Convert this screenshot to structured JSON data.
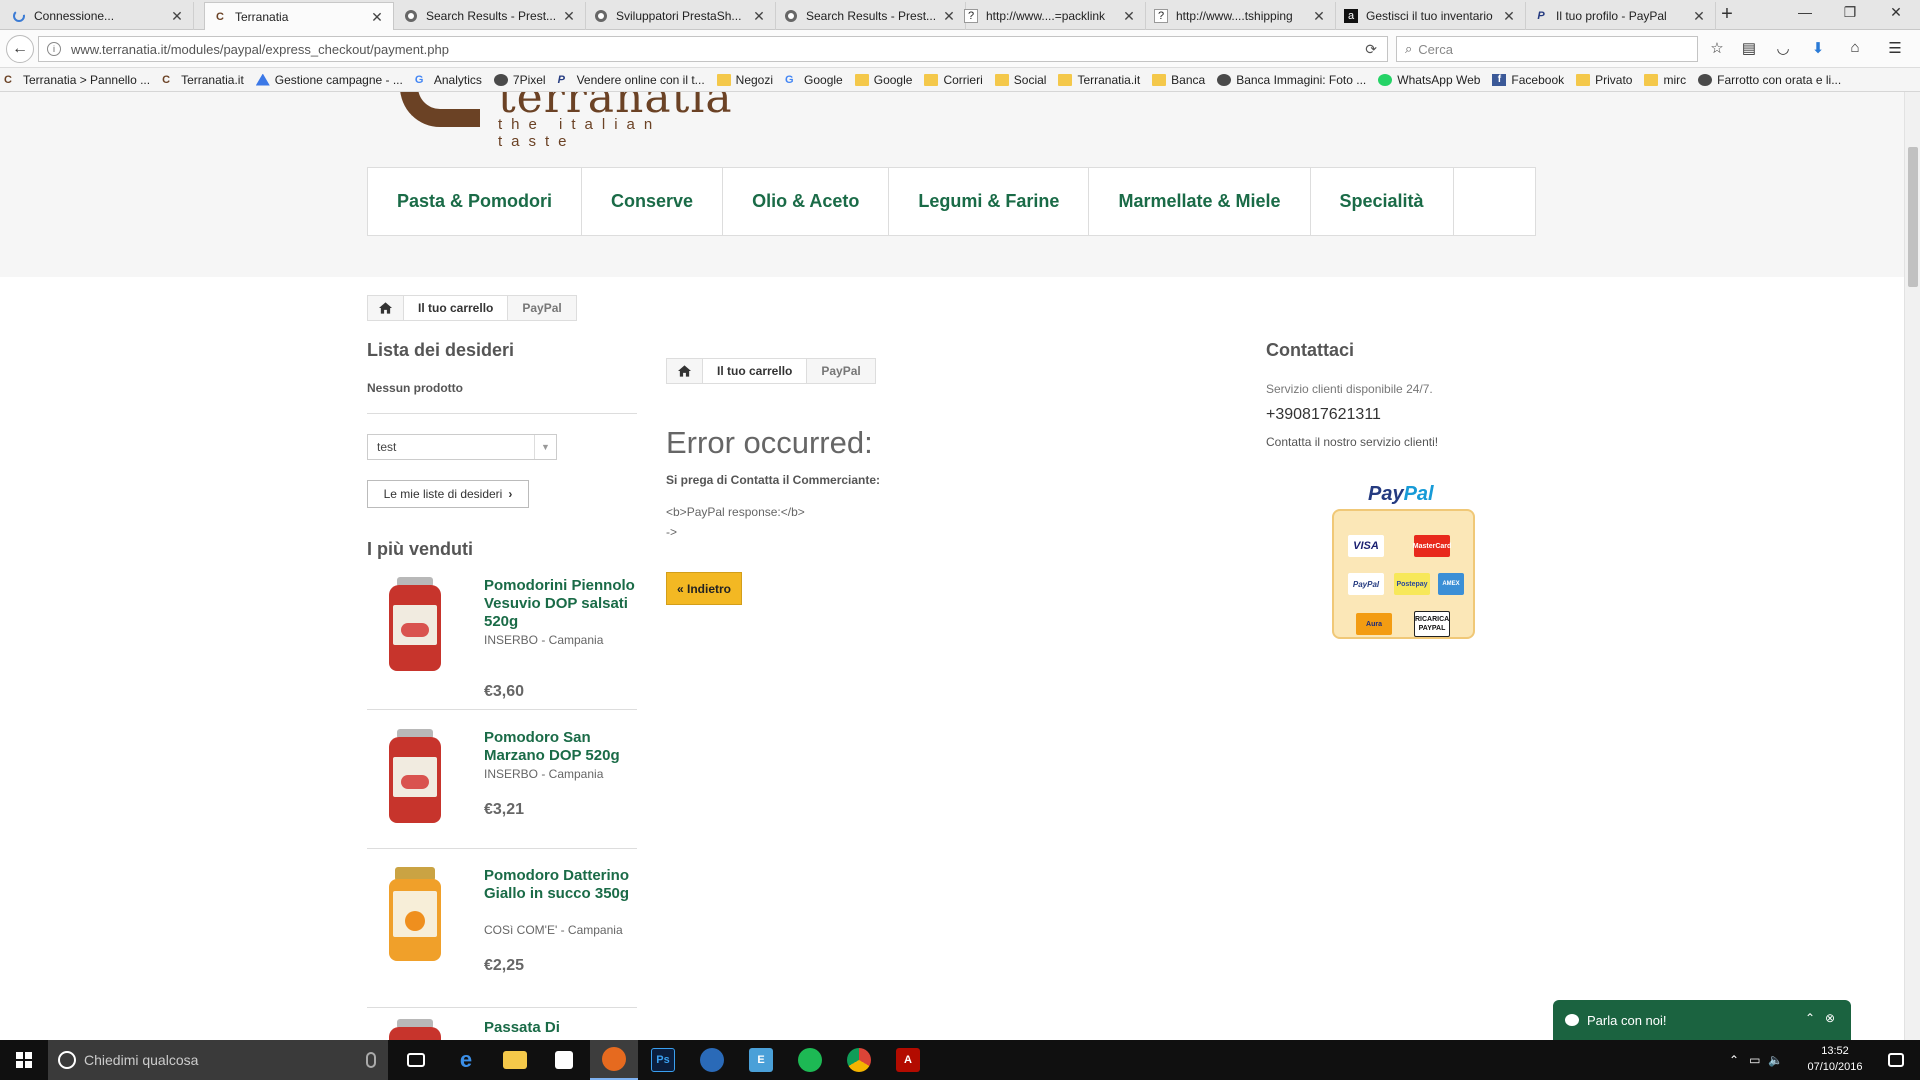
{
  "browser": {
    "tabs": [
      {
        "label": "Connessione...",
        "icon": "loading-icon"
      },
      {
        "label": "Terranatia",
        "icon": "terranatia-favicon",
        "active": true
      },
      {
        "label": "Search Results - Prest...",
        "icon": "prestashop-favicon"
      },
      {
        "label": "Sviluppatori PrestaSh...",
        "icon": "prestashop-favicon"
      },
      {
        "label": "Search Results - Prest...",
        "icon": "prestashop-favicon"
      },
      {
        "label": "http://www....=packlink",
        "icon": "unknown-page-icon"
      },
      {
        "label": "http://www....tshipping",
        "icon": "unknown-page-icon"
      },
      {
        "label": "Gestisci il tuo inventario",
        "icon": "amazon-favicon"
      },
      {
        "label": "Il tuo profilo - PayPal",
        "icon": "paypal-favicon"
      }
    ],
    "new_tab": "+",
    "url": "www.terranatia.it/modules/paypal/express_checkout/payment.php",
    "search_placeholder": "Cerca",
    "bookmarks": [
      {
        "label": "Terranatia > Pannello ...",
        "icon": "terranatia-favicon"
      },
      {
        "label": "Terranatia.it",
        "icon": "terranatia-favicon"
      },
      {
        "label": "Gestione campagne - ...",
        "icon": "adwords-icon"
      },
      {
        "label": "Analytics",
        "icon": "google-icon"
      },
      {
        "label": "7Pixel",
        "icon": "site-icon"
      },
      {
        "label": "Vendere online con il t...",
        "icon": "paypal-favicon"
      },
      {
        "label": "Negozi",
        "icon": "folder-icon"
      },
      {
        "label": "Google",
        "icon": "google-icon"
      },
      {
        "label": "Google",
        "icon": "folder-icon"
      },
      {
        "label": "Corrieri",
        "icon": "folder-icon"
      },
      {
        "label": "Social",
        "icon": "folder-icon"
      },
      {
        "label": "Terranatia.it",
        "icon": "folder-icon"
      },
      {
        "label": "Banca",
        "icon": "folder-icon"
      },
      {
        "label": "Banca Immagini: Foto ...",
        "icon": "site-icon"
      },
      {
        "label": "WhatsApp Web",
        "icon": "whatsapp-icon"
      },
      {
        "label": "Facebook",
        "icon": "facebook-icon"
      },
      {
        "label": "Privato",
        "icon": "folder-icon"
      },
      {
        "label": "mirc",
        "icon": "folder-icon"
      },
      {
        "label": "Farrotto con orata e li...",
        "icon": "site-icon"
      }
    ]
  },
  "site": {
    "logo_name": "terranatia",
    "logo_tagline": "the italian taste",
    "menu": [
      "Pasta & Pomodori",
      "Conserve",
      "Olio & Aceto",
      "Legumi & Farine",
      "Marmellate & Miele",
      "Specialità"
    ],
    "breadcrumb": {
      "cart": "Il tuo carrello",
      "current": "PayPal"
    },
    "wishlist": {
      "title": "Lista dei desideri",
      "empty": "Nessun prodotto",
      "selected": "test",
      "button": "Le mie liste di desideri"
    },
    "bestsellers": {
      "title": "I più venduti",
      "products": [
        {
          "name": "Pomodorini Piennolo Vesuvio DOP salsati 520g",
          "desc": "INSERBO - Campania",
          "price": "€3,60"
        },
        {
          "name": "Pomodoro San Marzano DOP 520g",
          "desc": "INSERBO - Campania",
          "price": "€3,21"
        },
        {
          "name": "Pomodoro Datterino Giallo in succo 350g",
          "desc": "COSì COM'E' - Campania",
          "price": "€2,25"
        },
        {
          "name": "Passata Di",
          "desc": "",
          "price": ""
        }
      ]
    },
    "error": {
      "title": "Error occurred:",
      "message": "Si prega di Contatta il Commerciante:",
      "response_line1": "<b>PayPal response:</b>",
      "response_line2": "->",
      "back_button": "« Indietro"
    },
    "contact": {
      "title": "Contattaci",
      "service": "Servizio clienti disponibile 24/7.",
      "phone": "+390817621311",
      "cta": "Contatta il nostro servizio clienti!"
    },
    "paypal_badge": {
      "logo_pay": "Pay",
      "logo_pal": "Pal",
      "cards": [
        "VISA",
        "MasterCard",
        "PayPal",
        "Postepay",
        "AMEX",
        "Aura",
        "RICARICA PAYPAL"
      ]
    },
    "chat": {
      "label": "Parla con noi!"
    }
  },
  "taskbar": {
    "search_placeholder": "Chiedimi qualcosa",
    "time": "13:52",
    "date": "07/10/2016"
  },
  "colors": {
    "brand_green": "#1a6b47",
    "brand_brown": "#6b4225",
    "button_yellow": "#f3b823",
    "paypal_blue": "#253b80"
  }
}
